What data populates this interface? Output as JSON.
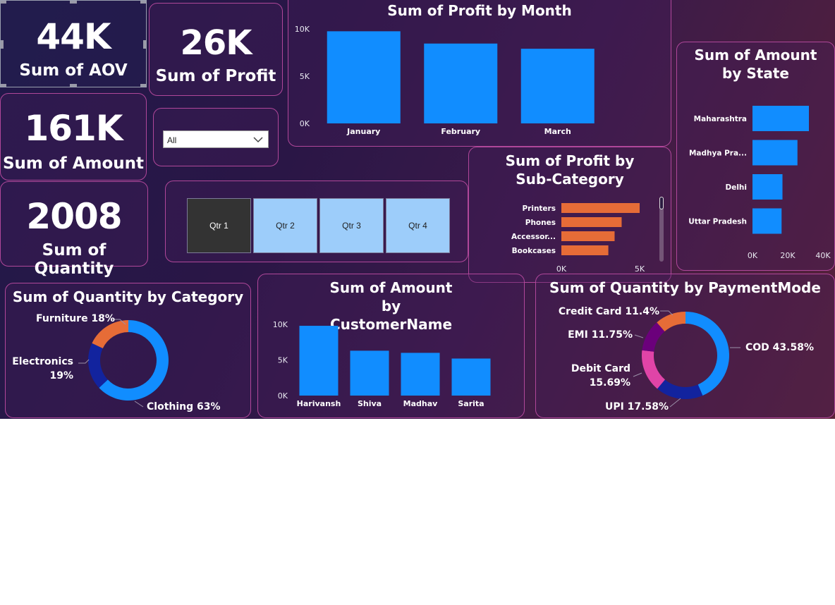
{
  "kpis": {
    "aov": {
      "value": "44K",
      "label": "Sum of AOV"
    },
    "profit": {
      "value": "26K",
      "label": "Sum of Profit"
    },
    "amount": {
      "value": "161K",
      "label": "Sum of Amount"
    },
    "quantity": {
      "value": "2008",
      "label": "Sum of Quantity"
    }
  },
  "slicer": {
    "selected": "All"
  },
  "quarters": [
    {
      "label": "Qtr 1",
      "selected": true
    },
    {
      "label": "Qtr 2",
      "selected": false
    },
    {
      "label": "Qtr 3",
      "selected": false
    },
    {
      "label": "Qtr 4",
      "selected": false
    }
  ],
  "colors": {
    "bar_blue": "#118dff",
    "bar_orange": "#e66c37",
    "selected_tile": "#333333",
    "tile": "#9dcdfa"
  },
  "chart_data": [
    {
      "id": "profit_by_month",
      "type": "bar",
      "title": "Sum of Profit by Month",
      "categories": [
        "January",
        "February",
        "March"
      ],
      "values": [
        9750,
        8450,
        7900
      ],
      "ylim": [
        0,
        10000
      ],
      "ytick_labels": [
        "10K",
        "5K",
        "0K"
      ],
      "color": "#118dff"
    },
    {
      "id": "amount_by_state",
      "type": "bar",
      "orientation": "horizontal",
      "title": "Sum of Amount by State",
      "categories": [
        "Maharashtra",
        "Madhya Pra...",
        "Delhi",
        "Uttar Pradesh"
      ],
      "values": [
        32000,
        25500,
        17000,
        16500
      ],
      "xlim": [
        0,
        40000
      ],
      "xtick_labels": [
        "0K",
        "20K",
        "40K"
      ],
      "color": "#118dff"
    },
    {
      "id": "profit_by_subcategory",
      "type": "bar",
      "orientation": "horizontal",
      "title": "Sum of Profit by Sub-Category",
      "categories": [
        "Printers",
        "Phones",
        "Accessor...",
        "Bookcases"
      ],
      "values": [
        5000,
        3850,
        3400,
        3000
      ],
      "xlim": [
        0,
        5000
      ],
      "xtick_labels": [
        "0K",
        "5K"
      ],
      "color": "#e66c37"
    },
    {
      "id": "quantity_by_category",
      "type": "pie",
      "title": "Sum of Quantity by Category",
      "slices": [
        {
          "label": "Clothing",
          "pct_label": "63%",
          "value": 63,
          "color": "#118dff"
        },
        {
          "label": "Electronics",
          "pct_label": "19%",
          "value": 19,
          "color": "#12239e"
        },
        {
          "label": "Furniture",
          "pct_label": "18%",
          "value": 18,
          "color": "#e66c37"
        }
      ]
    },
    {
      "id": "amount_by_customer",
      "type": "bar",
      "title": "Sum of Amount by CustomerName",
      "categories": [
        "Harivansh",
        "Shiva",
        "Madhav",
        "Sarita"
      ],
      "values": [
        9800,
        6300,
        6000,
        5200
      ],
      "ylim": [
        0,
        10000
      ],
      "ytick_labels": [
        "10K",
        "5K",
        "0K"
      ],
      "color": "#118dff"
    },
    {
      "id": "quantity_by_paymentmode",
      "type": "pie",
      "title": "Sum of Quantity by PaymentMode",
      "slices": [
        {
          "label": "COD",
          "pct_label": "43.58%",
          "value": 43.58,
          "color": "#118dff"
        },
        {
          "label": "UPI",
          "pct_label": "17.58%",
          "value": 17.58,
          "color": "#12239e"
        },
        {
          "label": "Debit Card",
          "pct_label": "15.69%",
          "value": 15.69,
          "color": "#e044a7"
        },
        {
          "label": "EMI",
          "pct_label": "11.75%",
          "value": 11.75,
          "color": "#6b007b"
        },
        {
          "label": "Credit Card",
          "pct_label": "11.4%",
          "value": 11.4,
          "color": "#e66c37"
        }
      ]
    }
  ]
}
